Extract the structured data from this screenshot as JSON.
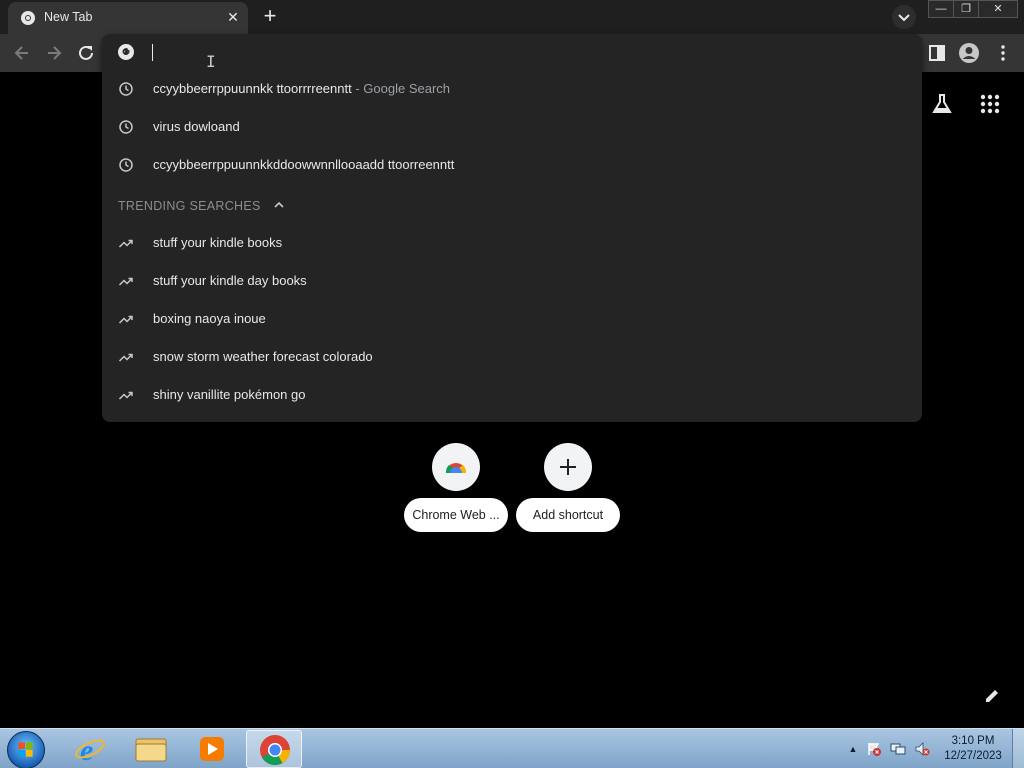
{
  "browser": {
    "tab": {
      "title": "New Tab",
      "close_glyph": "✕"
    },
    "new_tab_glyph": "+",
    "window_controls": {
      "minimize": "—",
      "maximize": "❐",
      "close": "✕"
    }
  },
  "omnibox": {
    "value": "",
    "history": [
      {
        "text": "ccyybbeerrppuunnkk ttoorrrreenntt",
        "suffix": "- Google Search",
        "icon": "clock-icon"
      },
      {
        "text": "virus dowloand",
        "suffix": "",
        "icon": "clock-icon"
      },
      {
        "text": "ccyybbeerrppuunnkkddoowwnnllooaadd ttoorreenntt",
        "suffix": "",
        "icon": "clock-icon"
      }
    ],
    "trending_header": "TRENDING SEARCHES",
    "trending": [
      {
        "text": "stuff your kindle books",
        "icon": "trending-icon"
      },
      {
        "text": "stuff your kindle day books",
        "icon": "trending-icon"
      },
      {
        "text": "boxing naoya inoue",
        "icon": "trending-icon"
      },
      {
        "text": "snow storm weather forecast colorado",
        "icon": "trending-icon"
      },
      {
        "text": "shiny vanillite pokémon go",
        "icon": "trending-icon"
      }
    ]
  },
  "shortcuts": [
    {
      "label": "Chrome Web ...",
      "icon": "chrome-web-store-icon"
    },
    {
      "label": "Add shortcut",
      "icon": "plus-icon"
    }
  ],
  "taskbar": {
    "clock_time": "3:10 PM",
    "clock_date": "12/27/2023",
    "tray_up_glyph": "▲"
  },
  "colors": {
    "background": "#000000",
    "toolbar": "#353535",
    "dropdown": "#242424",
    "taskbar": "#8fb3d6"
  }
}
